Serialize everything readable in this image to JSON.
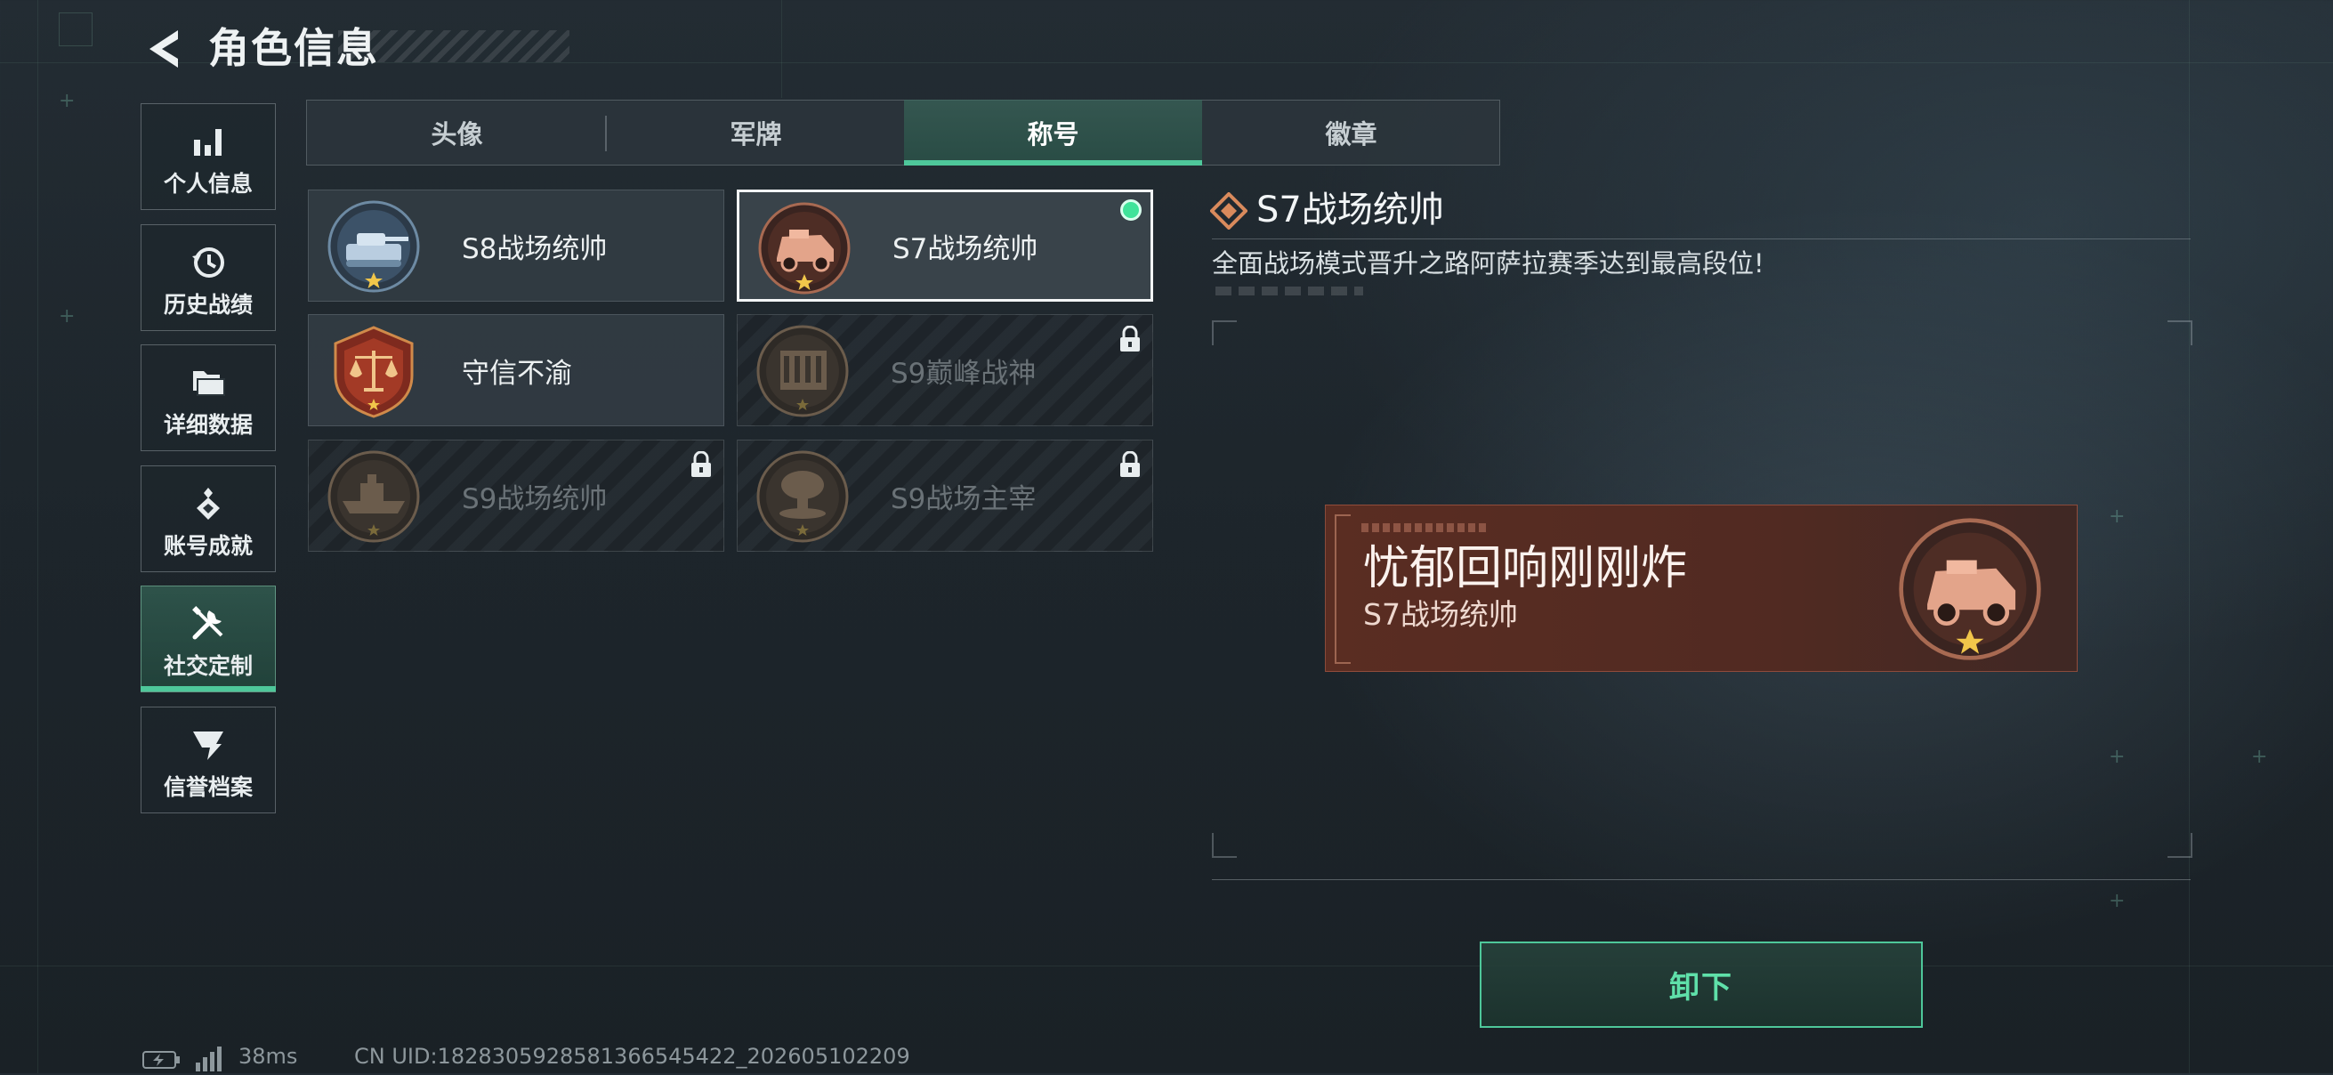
{
  "header": {
    "title": "角色信息"
  },
  "sidebar": {
    "items": [
      {
        "label": "个人信息",
        "icon": "bar-chart-icon"
      },
      {
        "label": "历史战绩",
        "icon": "history-icon"
      },
      {
        "label": "详细数据",
        "icon": "folder-icon"
      },
      {
        "label": "账号成就",
        "icon": "achievement-icon"
      },
      {
        "label": "社交定制",
        "icon": "tools-icon",
        "active": true
      },
      {
        "label": "信誉档案",
        "icon": "reputation-icon"
      }
    ]
  },
  "tabs": [
    {
      "label": "头像"
    },
    {
      "label": "军牌"
    },
    {
      "label": "称号",
      "active": true
    },
    {
      "label": "徽章"
    }
  ],
  "titles": [
    {
      "name": "S8战场统帅",
      "medal": "tank-medal-icon",
      "locked": false
    },
    {
      "name": "S7战场统帅",
      "medal": "armored-car-medal-icon",
      "locked": false,
      "selected": true,
      "equipped": true
    },
    {
      "name": "守信不渝",
      "medal": "scales-medal-icon",
      "locked": false
    },
    {
      "name": "S9巅峰战神",
      "medal": "fortress-medal-icon",
      "locked": true
    },
    {
      "name": "S9战场统帅",
      "medal": "warship-medal-icon",
      "locked": true
    },
    {
      "name": "S9战场主宰",
      "medal": "explosion-medal-icon",
      "locked": true
    }
  ],
  "detail": {
    "title": "S7战场统帅",
    "description": "全面战场模式晋升之路阿萨拉赛季达到最高段位!"
  },
  "preview": {
    "player_name": "忧郁回响刚刚炸",
    "title": "S7战场统帅"
  },
  "action": {
    "label": "卸下"
  },
  "status": {
    "ping": "38ms",
    "uid": "CN UID:1828305928581366545422_202605102209"
  },
  "colors": {
    "accent": "#4ec79a",
    "equipped_dot": "#3fe39a",
    "banner_bg": "#5a2d22",
    "medal_bronze": "#c88a6a"
  }
}
